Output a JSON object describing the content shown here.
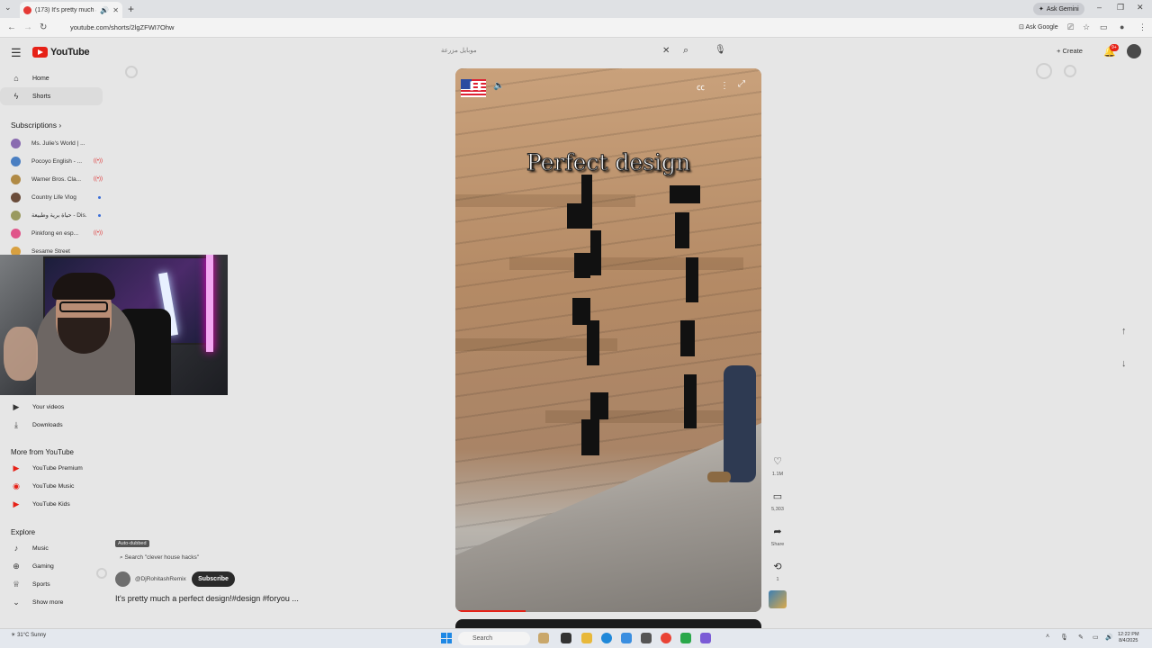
{
  "browser": {
    "tab_title": "(173) It's pretty much a pe...",
    "url": "youtube.com/shorts/2lgZFWI7Ohw",
    "ask_gemini": "Ask Gemini",
    "ask_google": "Ask Google"
  },
  "header": {
    "logo": "YouTube",
    "search_placeholder": "موبايل مزرعة",
    "create_label": "Create",
    "notif_badge": "9+"
  },
  "sidebar": {
    "home": "Home",
    "shorts": "Shorts",
    "subscriptions_title": "Subscriptions",
    "subscriptions": [
      {
        "name": "Ms. Julie's World | ...",
        "color": "#8a6bb0"
      },
      {
        "name": "Pocoyo English - ...",
        "color": "#4a7fc2"
      },
      {
        "name": "Warner Bros. Cla...",
        "color": "#b08a45"
      },
      {
        "name": "Country Life Vlog",
        "color": "#6a4c3a"
      },
      {
        "name": "حياة برية وطبيعة - Dis...",
        "color": "#9a9a60"
      },
      {
        "name": "Pinkfong en esp...",
        "color": "#e0558a"
      },
      {
        "name": "Sesame Street",
        "color": "#d8a040"
      }
    ],
    "your_videos": "Your videos",
    "downloads": "Downloads",
    "more_title": "More from YouTube",
    "premium": "YouTube Premium",
    "music_app": "YouTube Music",
    "kids": "YouTube Kids",
    "explore_title": "Explore",
    "music": "Music",
    "gaming": "Gaming",
    "sports": "Sports",
    "show_more": "Show more"
  },
  "player": {
    "overlay_text": "Perfect design",
    "progress": 0.23
  },
  "actions": {
    "likes": "1.1M",
    "comments": "5,303",
    "share": "Share",
    "remix": "1"
  },
  "video_info": {
    "auto_dubbed": "Auto-dubbed",
    "search_suggestion": "Search \"clever house hacks\"",
    "channel": "@DjRohitashRemix",
    "subscribe": "Subscribe",
    "title": "It's pretty much a perfect design!#design #foryou ..."
  },
  "taskbar": {
    "weather_temp": "31°C",
    "weather_desc": "Sunny",
    "search": "Search",
    "time": "12:22 PM",
    "date": "8/4/2025"
  }
}
